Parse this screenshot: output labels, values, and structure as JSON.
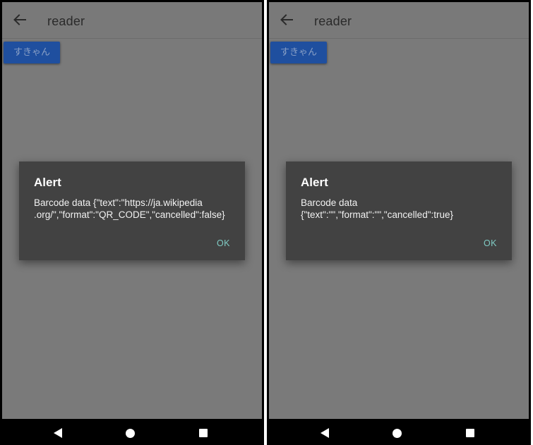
{
  "screens": [
    {
      "app_title": "reader",
      "scan_button_label": "すきゃん",
      "dialog": {
        "title": "Alert",
        "message": "Barcode data {\"text\":\"https://ja.wikipedia\n.org/\",\"format\":\"QR_CODE\",\"cancelled\":false}",
        "ok_label": "OK"
      }
    },
    {
      "app_title": "reader",
      "scan_button_label": "すきゃん",
      "dialog": {
        "title": "Alert",
        "message": "Barcode data\n{\"text\":\"\",\"format\":\"\",\"cancelled\":true}",
        "ok_label": "OK"
      }
    }
  ],
  "icons": {
    "back": "arrow-left-icon",
    "nav_back": "triangle-back-icon",
    "nav_home": "circle-home-icon",
    "nav_recents": "square-recents-icon"
  },
  "colors": {
    "scrim": "#7a7a7a",
    "dialog_bg": "#424242",
    "button_bg": "#1f4f9f",
    "ok_accent": "#80cbc4"
  }
}
